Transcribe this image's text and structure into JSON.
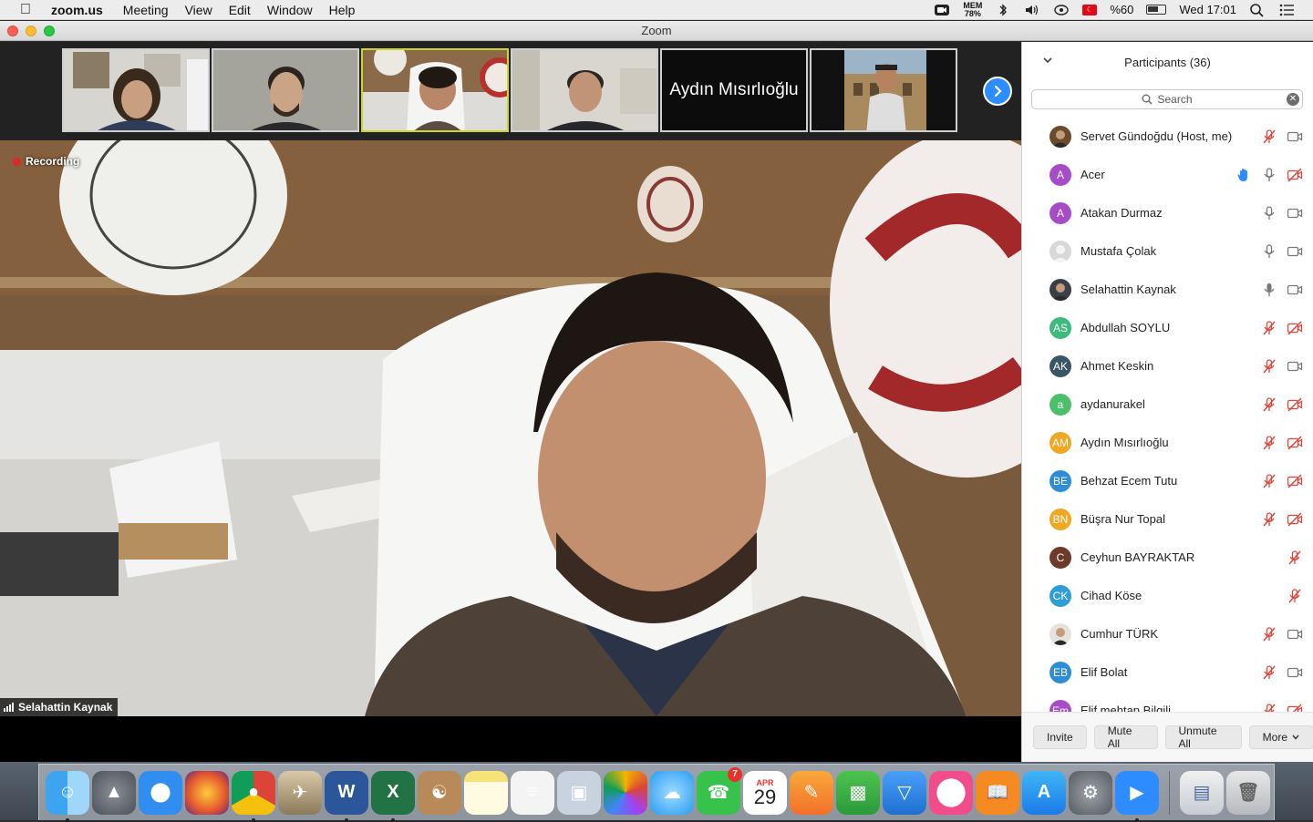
{
  "menubar": {
    "app_name": "zoom.us",
    "items": [
      "Meeting",
      "View",
      "Edit",
      "Window",
      "Help"
    ],
    "mem_label": "MEM",
    "mem_value": "78%",
    "battery": "%60",
    "clock": "Wed 17:01"
  },
  "window": {
    "title": "Zoom"
  },
  "thumbnails": {
    "name_tile": "Aydın Mısırlıoğlu"
  },
  "video": {
    "recording_label": "Recording",
    "active_speaker": "Selahattin Kaynak"
  },
  "participants": {
    "title": "Participants (36)",
    "search_placeholder": "Search",
    "list": [
      {
        "name": "Servet Gündoğdu (Host, me)",
        "initials": "",
        "color": "#6b4a2e",
        "photo": true,
        "hand": false,
        "mic": "muted",
        "video": "on"
      },
      {
        "name": "Acer",
        "initials": "A",
        "color": "#a64cc6",
        "photo": false,
        "hand": true,
        "mic": "on",
        "video": "off"
      },
      {
        "name": "Atakan Durmaz",
        "initials": "A",
        "color": "#a64cc6",
        "photo": false,
        "hand": false,
        "mic": "on",
        "video": "on"
      },
      {
        "name": "Mustafa Çolak",
        "initials": "",
        "color": "#d8d8d8",
        "photo": false,
        "hand": false,
        "mic": "on",
        "video": "on"
      },
      {
        "name": "Selahattin Kaynak",
        "initials": "",
        "color": "#3a3f4a",
        "photo": true,
        "hand": false,
        "mic": "active",
        "video": "on"
      },
      {
        "name": "Abdullah SOYLU",
        "initials": "AS",
        "color": "#3dbb7a",
        "photo": false,
        "hand": false,
        "mic": "muted",
        "video": "off"
      },
      {
        "name": "Ahmet Keskin",
        "initials": "AK",
        "color": "#3a5566",
        "photo": false,
        "hand": false,
        "mic": "muted",
        "video": "on"
      },
      {
        "name": "aydanurakel",
        "initials": "a",
        "color": "#4cbf6a",
        "photo": false,
        "hand": false,
        "mic": "muted",
        "video": "off"
      },
      {
        "name": "Aydın Mısırlıoğlu",
        "initials": "AM",
        "color": "#f0a823",
        "photo": false,
        "hand": false,
        "mic": "muted",
        "video": "off"
      },
      {
        "name": "Behzat Ecem Tutu",
        "initials": "BE",
        "color": "#2d8ed6",
        "photo": false,
        "hand": false,
        "mic": "muted",
        "video": "off"
      },
      {
        "name": "Büşra Nur Topal",
        "initials": "BN",
        "color": "#f0a823",
        "photo": false,
        "hand": false,
        "mic": "muted",
        "video": "off"
      },
      {
        "name": "Ceyhun BAYRAKTAR",
        "initials": "C",
        "color": "#6e3b2a",
        "photo": false,
        "hand": false,
        "mic": "muted",
        "video": "none"
      },
      {
        "name": "Cihad Köse",
        "initials": "CK",
        "color": "#2d9ed6",
        "photo": false,
        "hand": false,
        "mic": "muted",
        "video": "none"
      },
      {
        "name": "Cumhur TÜRK",
        "initials": "",
        "color": "#e8e2dc",
        "photo": true,
        "hand": false,
        "mic": "muted",
        "video": "on"
      },
      {
        "name": "Elif Bolat",
        "initials": "EB",
        "color": "#2d8ed6",
        "photo": false,
        "hand": false,
        "mic": "muted",
        "video": "on"
      },
      {
        "name": "Elif mehtap Bilgili",
        "initials": "Em",
        "color": "#a64cc6",
        "photo": false,
        "hand": false,
        "mic": "muted",
        "video": "off"
      }
    ],
    "footer": {
      "invite": "Invite",
      "mute_all": "Mute All",
      "unmute_all": "Unmute All",
      "more": "More"
    }
  },
  "dock": {
    "facetime_badge": "7",
    "calendar_month": "APR",
    "calendar_day": "29",
    "apps": [
      "finder-icon",
      "launchpad-icon",
      "safari-icon",
      "firefox-icon",
      "chrome-icon",
      "preview-icon",
      "word-icon",
      "excel-icon",
      "contacts-icon",
      "notes-icon",
      "reminders-icon",
      "image-capture-icon",
      "photos-icon",
      "messages-icon",
      "facetime-icon",
      "calendar-icon",
      "pages-icon",
      "numbers-icon",
      "keynote-icon",
      "itunes-icon",
      "ibooks-icon",
      "app-store-icon",
      "system-preferences-icon",
      "zoom-icon"
    ]
  },
  "colors": {
    "zoom_blue": "#2d8cff",
    "muted_red": "#e0443a",
    "active_thumb": "#c9d82a"
  }
}
